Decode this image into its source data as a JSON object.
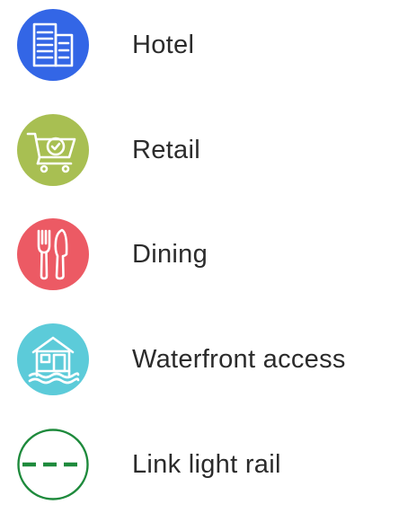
{
  "legend": {
    "items": [
      {
        "label": "Hotel",
        "icon": "hotel-building-icon",
        "color": "#3366e6"
      },
      {
        "label": "Retail",
        "icon": "shopping-cart-icon",
        "color": "#a8bf52"
      },
      {
        "label": "Dining",
        "icon": "fork-knife-icon",
        "color": "#ec5a64"
      },
      {
        "label": "Waterfront access",
        "icon": "waterfront-house-icon",
        "color": "#5ccbd9"
      },
      {
        "label": "Link light rail",
        "icon": "light-rail-line-icon",
        "color": "#1e8a3c"
      }
    ]
  }
}
